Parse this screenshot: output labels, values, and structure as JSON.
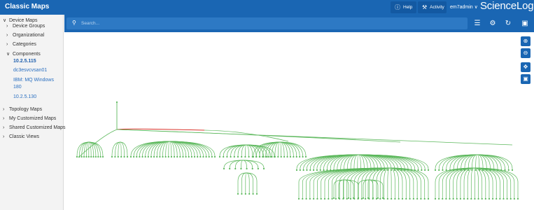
{
  "app": {
    "title": "Classic Maps"
  },
  "topbar": {
    "help_label": "Help",
    "activity_label": "Activity",
    "user_label": "em7admin ∨",
    "brand": "ScienceLogic"
  },
  "search": {
    "placeholder": "Search..."
  },
  "sidebar": {
    "device_maps": "Device Maps",
    "device_groups": "Device Groups",
    "organizational": "Organizational",
    "categories": "Categories",
    "components": "Components",
    "component_items": [
      "10.2.5.115",
      "dc3esvcvsan01",
      "IBM: MQ Windows 180",
      "10.2.5.130"
    ],
    "topology_maps": "Topology Maps",
    "my_customized_maps": "My Customized Maps",
    "shared_customized_maps": "Shared Customized Maps",
    "classic_views": "Classic Views"
  },
  "colors": {
    "brand_blue": "#1a66b3",
    "edge_green": "#5cb85c",
    "edge_red": "#d9342b"
  },
  "icons": {
    "help": "help-circle-icon",
    "activity": "wrench-icon",
    "search": "search-icon",
    "list": "list-icon",
    "settings": "gear-icon",
    "refresh": "refresh-icon",
    "save": "save-icon",
    "zoom_in": "zoom-in-icon",
    "zoom_out": "zoom-out-icon",
    "pan": "move-icon",
    "fit": "fit-to-screen-icon"
  }
}
